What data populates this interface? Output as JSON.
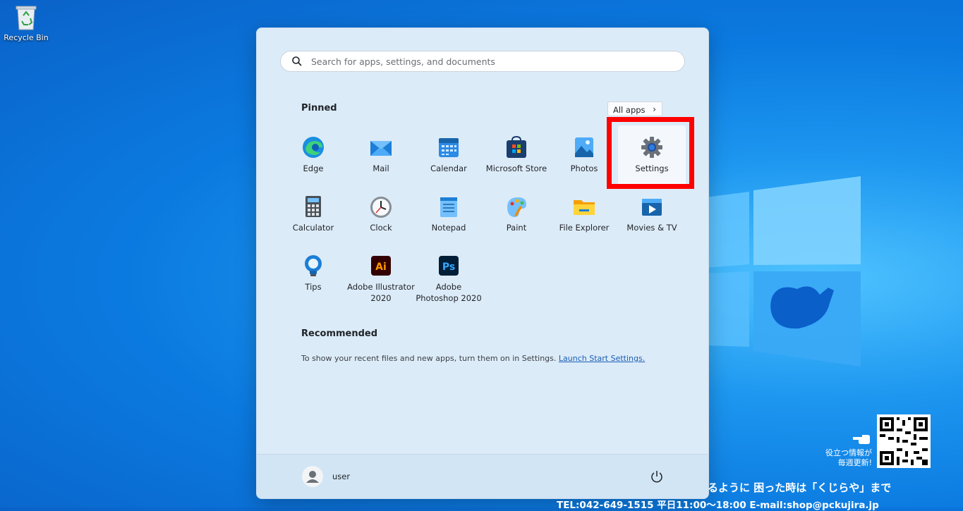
{
  "desktop": {
    "recycle_bin_label": "Recycle Bin",
    "watermark": {
      "line1": "るように 困った時は「くじらや」まで",
      "line2": "TEL:042-649-1515 平日11:00～18:00 E-mail:shop@pckujira.jp",
      "note_line1": "役立つ情報が",
      "note_line2": "毎週更新!"
    }
  },
  "start_menu": {
    "search_placeholder": "Search for apps, settings, and documents",
    "pinned_label": "Pinned",
    "all_apps_label": "All apps",
    "all_apps_chevron": "›",
    "pinned_apps": [
      {
        "label": "Edge",
        "icon": "edge-icon"
      },
      {
        "label": "Mail",
        "icon": "mail-icon"
      },
      {
        "label": "Calendar",
        "icon": "calendar-icon"
      },
      {
        "label": "Microsoft Store",
        "icon": "store-icon"
      },
      {
        "label": "Photos",
        "icon": "photos-icon"
      },
      {
        "label": "Settings",
        "icon": "gear-icon",
        "highlighted": true
      },
      {
        "label": "Calculator",
        "icon": "calculator-icon"
      },
      {
        "label": "Clock",
        "icon": "clock-icon"
      },
      {
        "label": "Notepad",
        "icon": "notepad-icon"
      },
      {
        "label": "Paint",
        "icon": "paint-icon"
      },
      {
        "label": "File Explorer",
        "icon": "folder-icon"
      },
      {
        "label": "Movies & TV",
        "icon": "movies-icon"
      },
      {
        "label": "Tips",
        "icon": "lightbulb-icon"
      },
      {
        "label": "Adobe Illustrator 2020",
        "icon": "illustrator-icon"
      },
      {
        "label": "Adobe Photoshop 2020",
        "icon": "photoshop-icon"
      }
    ],
    "recommended_label": "Recommended",
    "recommended_text": "To show your recent files and new apps, turn them on in Settings.",
    "recommended_link": "Launch Start Settings.",
    "user_name": "user"
  },
  "colors": {
    "highlight_box": "#ff0000",
    "desktop_blue": "#0b7ae0",
    "menu_bg": "#dcebf8"
  }
}
